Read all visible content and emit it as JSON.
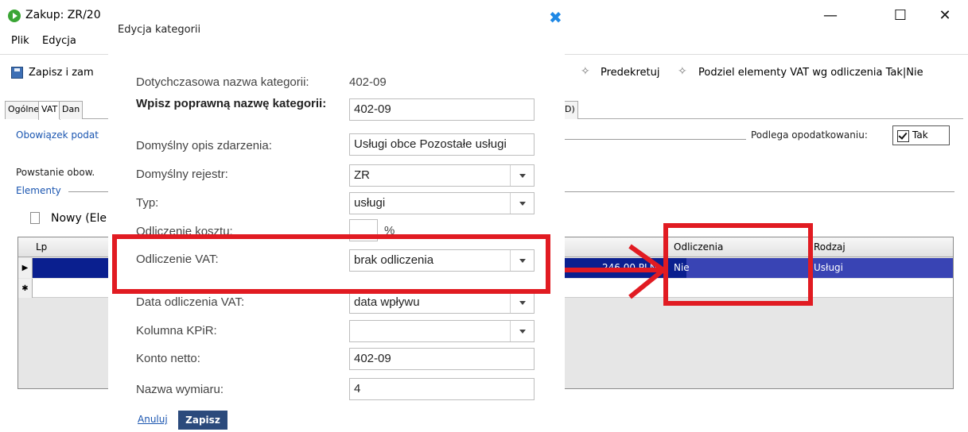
{
  "window": {
    "title": "Zakup: ZR/20",
    "minimize": "—",
    "maximize": "☐",
    "close": "✕",
    "menu": [
      "Plik",
      "Edycja"
    ],
    "toolbar": {
      "save_close": "Zapisz i zam",
      "predekretuj": "Predekretuj",
      "split_vat": "Podziel elementy VAT wg odliczenia Tak|Nie",
      "wand_icon": "✧"
    },
    "tabs": [
      "Ogólne",
      "VAT",
      "Dan",
      "D)"
    ],
    "obowiazek": "Obowiązek podat",
    "podlega_label": "Podlega opodatkowaniu:",
    "podlega_value": "Tak",
    "powstanie": "Powstanie obow.",
    "elementy": "Elementy",
    "nowy": "Nowy (Ele",
    "grid": {
      "headers": {
        "lp": "Lp",
        "odliczenia": "Odliczenia",
        "rodzaj": "Rodzaj"
      },
      "row": {
        "amount": "246,00 PLN",
        "odliczenia": "Nie",
        "rodzaj": "Usługi"
      },
      "row_marker": "▶",
      "new_marker": "✱"
    }
  },
  "dialog": {
    "title": "Edycja kategorii",
    "close_icon": "✖",
    "fields": {
      "old_name_label": "Dotychczasowa nazwa kategorii:",
      "old_name_value": "402-09",
      "new_name_label": "Wpisz poprawną nazwę kategorii:",
      "new_name_value": "402-09",
      "default_desc_label": "Domyślny opis zdarzenia:",
      "default_desc_value": "Usługi obce Pozostałe usługi",
      "default_register_label": "Domyślny rejestr:",
      "default_register_value": "ZR",
      "type_label": "Typ:",
      "type_value": "usługi",
      "cost_deduction_label": "Odliczenie kosztu:",
      "cost_deduction_value": "",
      "cost_deduction_unit": "%",
      "vat_deduction_label": "Odliczenie VAT:",
      "vat_deduction_value": "brak odliczenia",
      "vat_date_label": "Data odliczenia VAT:",
      "vat_date_value": "data wpływu",
      "kpir_label": "Kolumna KPiR:",
      "kpir_value": "",
      "net_account_label": "Konto netto:",
      "net_account_value": "402-09",
      "dimension_label": "Nazwa wymiaru:",
      "dimension_value": "4"
    },
    "cancel": "Anuluj",
    "save": "Zapisz"
  },
  "colors": {
    "annotation_red": "#e11b22",
    "selection_blue": "#0a1f8f",
    "link_blue": "#1a55b0",
    "save_button": "#2b4a7c"
  }
}
